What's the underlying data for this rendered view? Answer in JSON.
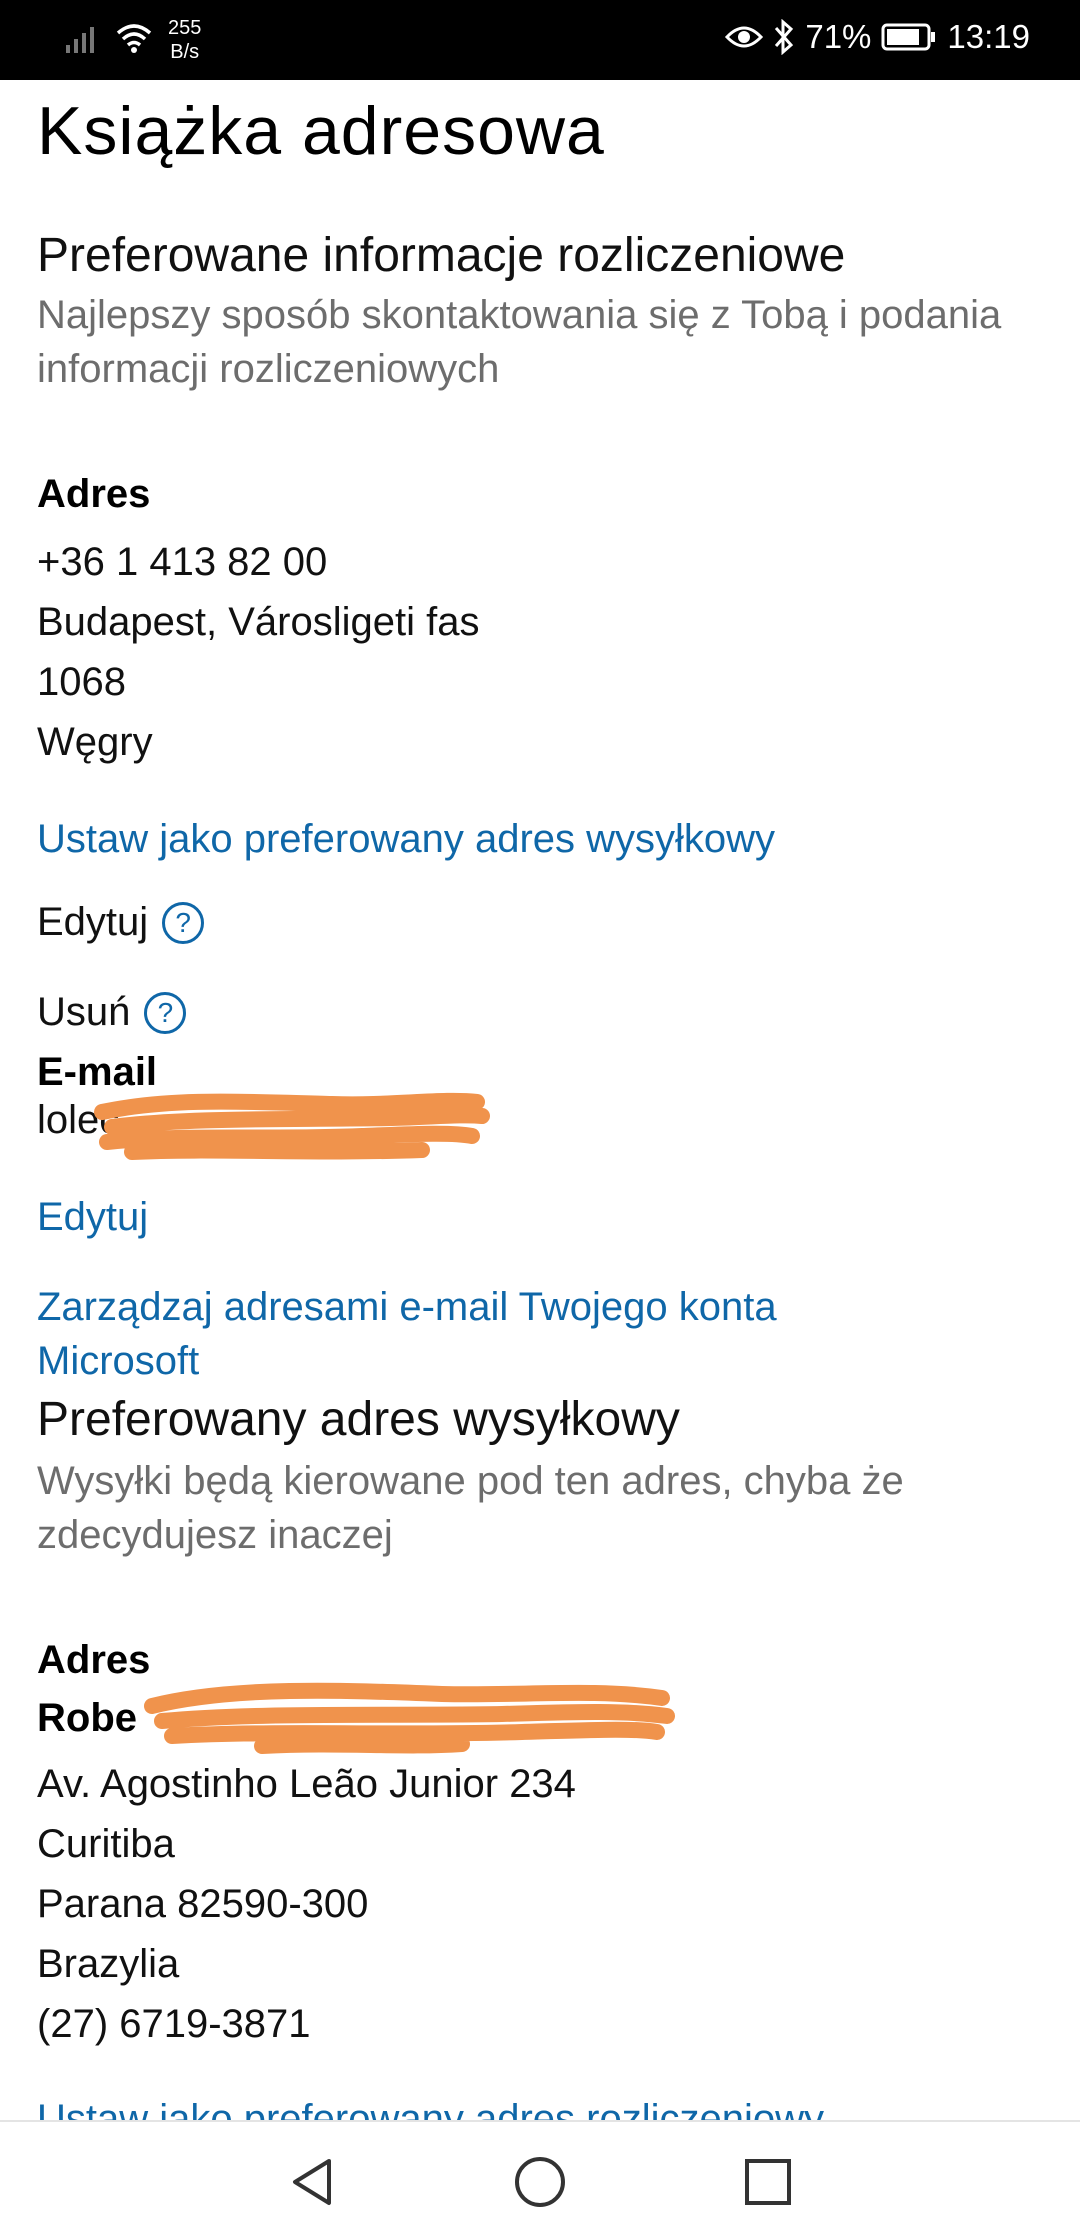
{
  "status_bar": {
    "speed_value": "255",
    "speed_unit": "B/s",
    "battery": "71%",
    "time": "13:19"
  },
  "page": {
    "title": "Książka adresowa"
  },
  "billing": {
    "title": "Preferowane informacje rozliczeniowe",
    "subtitle": "Najlepszy sposób skontaktowania się z Tobą i podania informacji rozliczeniowych",
    "address_label": "Adres",
    "address_lines": [
      "+36 1 413 82 00",
      "Budapest, Városligeti fas",
      "1068",
      "Węgry"
    ],
    "set_shipping_link": "Ustaw jako preferowany adres wysyłkowy",
    "edit_label": "Edytuj",
    "delete_label": "Usuń",
    "email_label": "E-mail",
    "email_partial": "lolec",
    "email_edit_link": "Edytuj",
    "manage_emails_link": "Zarządzaj adresami e-mail Twojego konta Microsoft"
  },
  "shipping": {
    "title": "Preferowany adres wysyłkowy",
    "subtitle": "Wysyłki będą kierowane pod ten adres, chyba że zdecydujesz inaczej",
    "address_label": "Adres",
    "name_partial": "Robe",
    "address_lines": [
      "Av. Agostinho Leão Junior 234",
      "Curitiba",
      "Parana 82590-300",
      "Brazylia",
      "(27) 6719-3871"
    ],
    "set_billing_link": "Ustaw jako preferowany adres rozliczeniowy"
  },
  "colors": {
    "link": "#0f67a8",
    "muted": "#6d6d6d",
    "redaction": "#f0934c"
  }
}
